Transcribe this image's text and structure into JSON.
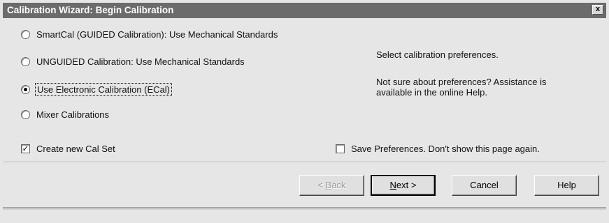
{
  "window": {
    "title": "Calibration Wizard: Begin Calibration",
    "close_label": "x"
  },
  "options": {
    "items": [
      {
        "label": "SmartCal (GUIDED Calibration): Use Mechanical Standards",
        "checked": false
      },
      {
        "label": "UNGUIDED Calibration: Use Mechanical Standards",
        "checked": false
      },
      {
        "label": "Use Electronic Calibration (ECal)",
        "checked": true
      },
      {
        "label": "Mixer Calibrations",
        "checked": false
      }
    ]
  },
  "info": {
    "line1": "Select calibration preferences.",
    "line2a": "Not sure about preferences?  Assistance is",
    "line2b": "available in the online Help."
  },
  "checks": {
    "create_cal_set": {
      "label": "Create new Cal Set",
      "checked": true,
      "mark": "✓"
    },
    "save_prefs": {
      "label": "Save Preferences. Don't show this page again.",
      "checked": false
    }
  },
  "buttons": {
    "back_pre": "< ",
    "back_ul": "B",
    "back_post": "ack",
    "next_ul": "N",
    "next_post": "ext >",
    "cancel": "Cancel",
    "help": "Help"
  }
}
